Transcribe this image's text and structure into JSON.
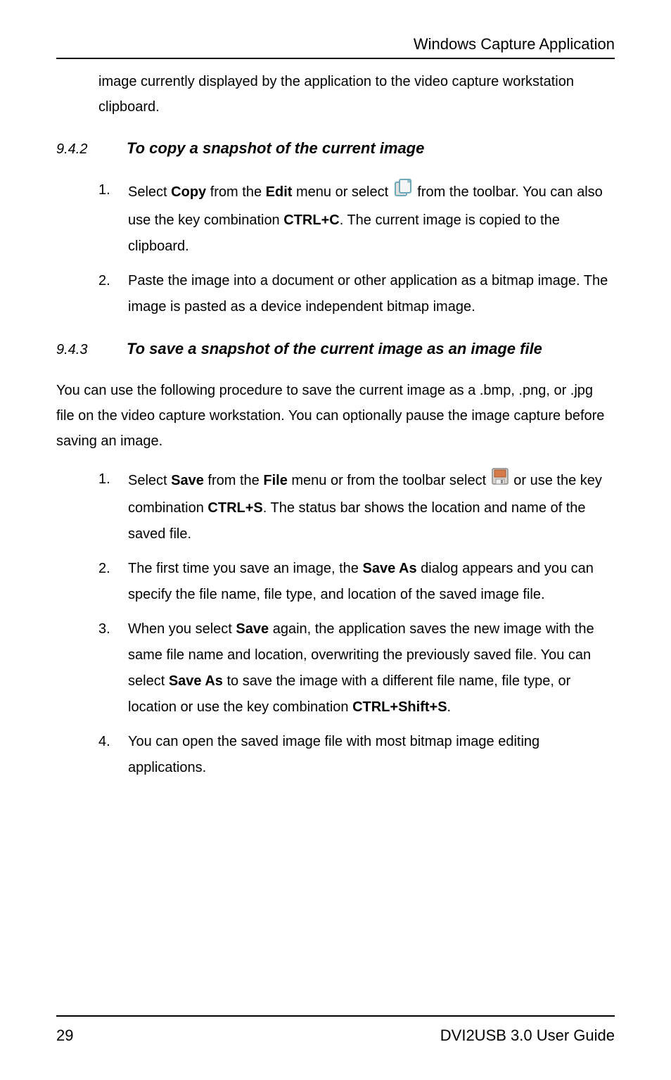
{
  "header": {
    "title": "Windows Capture Application"
  },
  "intro_para": "image currently displayed by the application to the video capture workstation clipboard.",
  "sections": {
    "s942": {
      "number": "9.4.2",
      "title": "To copy a snapshot of the current image",
      "items": {
        "n1": "1.",
        "i1a": "Select ",
        "i1_copy": "Copy",
        "i1b": " from the ",
        "i1_edit": "Edit",
        "i1c": " menu or select ",
        "i1d": " from the toolbar. You can also use the key combination ",
        "i1_ctrl": "CTRL+C",
        "i1e": ". The current image is copied to the clipboard.",
        "n2": "2.",
        "i2": "Paste the image into a document or other application as a bitmap image. The image is pasted as a device independent bitmap image."
      }
    },
    "s943": {
      "number": "9.4.3",
      "title": "To save a snapshot of the current image as an image file",
      "lead": "You can use the following procedure to save the current image as a .bmp, .png, or .jpg file on the video capture workstation. You can optionally pause the image capture before saving an image.",
      "items": {
        "n1": "1.",
        "i1a": "Select ",
        "i1_save": "Save",
        "i1b": " from the ",
        "i1_file": "File",
        "i1c": " menu or from the toolbar select ",
        "i1d": " or use the key combination ",
        "i1_ctrl": "CTRL+S",
        "i1e": ". The status bar shows the location and name of the saved file.",
        "n2": "2.",
        "i2a": "The first time you save an image, the ",
        "i2_saveas": "Save As",
        "i2b": " dialog appears and you can specify the file name, file type, and location of the saved image file.",
        "n3": "3.",
        "i3a": "When you select ",
        "i3_save": "Save",
        "i3b": " again, the application saves the new image with the same file name and location, overwriting the previously saved file. You can select ",
        "i3_saveas": "Save As",
        "i3c": " to save the image with a different file name, file type, or location or use the key combination ",
        "i3_ctrl": "CTRL+Shift+S",
        "i3d": ".",
        "n4": "4.",
        "i4": "You can open the saved image file with most bitmap image editing applications."
      }
    }
  },
  "footer": {
    "page": "29",
    "guide": "DVI2USB 3.0  User Guide"
  }
}
